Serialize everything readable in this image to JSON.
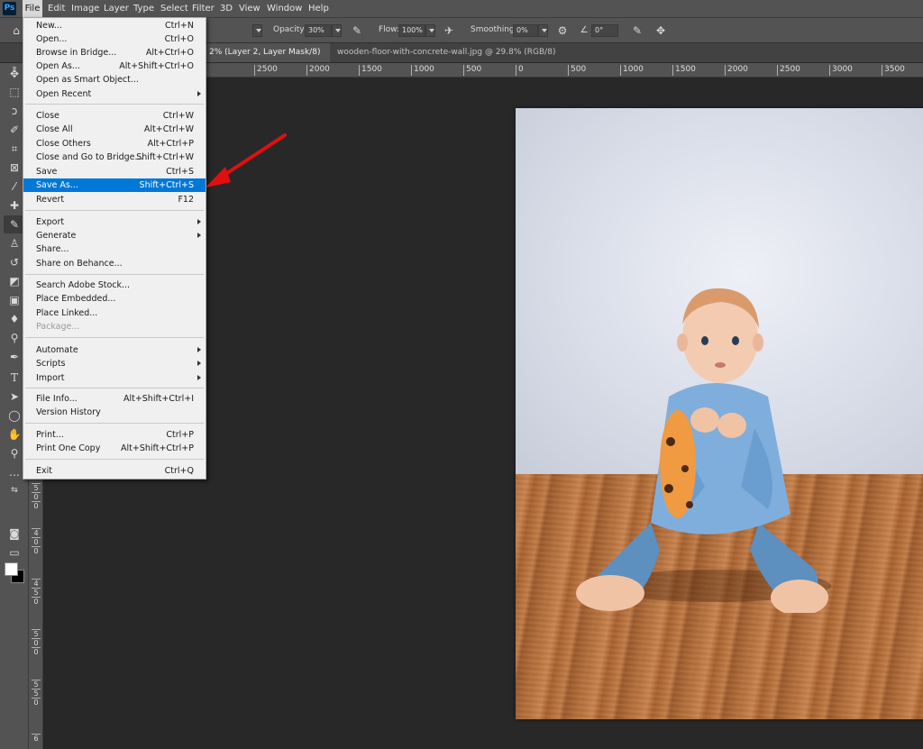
{
  "menubar": {
    "logo": "Ps",
    "items": [
      "File",
      "Edit",
      "Image",
      "Layer",
      "Type",
      "Select",
      "Filter",
      "3D",
      "View",
      "Window",
      "Help"
    ]
  },
  "options": {
    "opacity_label": "Opacity:",
    "opacity_value": "30%",
    "flow_label": "Flow:",
    "flow_value": "100%",
    "smoothing_label": "Smoothing:",
    "smoothing_value": "0%",
    "angle_value": "0°"
  },
  "tabs": [
    {
      "label": "2% (Layer 2, Layer Mask/8) *",
      "close": "×"
    },
    {
      "label": "wooden-floor-with-concrete-wall.jpg @ 29.8% (RGB/8) *",
      "close": "×"
    }
  ],
  "ruler_h": [
    "2500",
    "2000",
    "1500",
    "1000",
    "500",
    "0",
    "500",
    "1000",
    "1500",
    "2000",
    "2500",
    "3000",
    "3500"
  ],
  "ruler_v": [
    "5",
    "0",
    "0",
    "4",
    "0",
    "0",
    "4",
    "5",
    "0",
    "5",
    "0",
    "0",
    "5",
    "5",
    "0",
    "6"
  ],
  "file_menu": {
    "items": [
      {
        "label": "New...",
        "shortcut": "Ctrl+N"
      },
      {
        "label": "Open...",
        "shortcut": "Ctrl+O"
      },
      {
        "label": "Browse in Bridge...",
        "shortcut": "Alt+Ctrl+O"
      },
      {
        "label": "Open As...",
        "shortcut": "Alt+Shift+Ctrl+O"
      },
      {
        "label": "Open as Smart Object...",
        "shortcut": ""
      },
      {
        "label": "Open Recent",
        "shortcut": "",
        "submenu": true
      },
      {
        "label": "Close",
        "shortcut": "Ctrl+W"
      },
      {
        "label": "Close All",
        "shortcut": "Alt+Ctrl+W"
      },
      {
        "label": "Close Others",
        "shortcut": "Alt+Ctrl+P"
      },
      {
        "label": "Close and Go to Bridge...",
        "shortcut": "Shift+Ctrl+W"
      },
      {
        "label": "Save",
        "shortcut": "Ctrl+S"
      },
      {
        "label": "Save As...",
        "shortcut": "Shift+Ctrl+S",
        "highlighted": true
      },
      {
        "label": "Revert",
        "shortcut": "F12"
      },
      {
        "label": "Export",
        "shortcut": "",
        "submenu": true
      },
      {
        "label": "Generate",
        "shortcut": "",
        "submenu": true
      },
      {
        "label": "Share...",
        "shortcut": ""
      },
      {
        "label": "Share on Behance...",
        "shortcut": ""
      },
      {
        "label": "Search Adobe Stock...",
        "shortcut": ""
      },
      {
        "label": "Place Embedded...",
        "shortcut": ""
      },
      {
        "label": "Place Linked...",
        "shortcut": ""
      },
      {
        "label": "Package...",
        "shortcut": "",
        "disabled": true
      },
      {
        "label": "Automate",
        "shortcut": "",
        "submenu": true
      },
      {
        "label": "Scripts",
        "shortcut": "",
        "submenu": true
      },
      {
        "label": "Import",
        "shortcut": "",
        "submenu": true
      },
      {
        "label": "File Info...",
        "shortcut": "Alt+Shift+Ctrl+I"
      },
      {
        "label": "Version History",
        "shortcut": ""
      },
      {
        "label": "Print...",
        "shortcut": "Ctrl+P"
      },
      {
        "label": "Print One Copy",
        "shortcut": "Alt+Shift+Ctrl+P"
      },
      {
        "label": "Exit",
        "shortcut": "Ctrl+Q"
      }
    ]
  },
  "colors": {
    "highlight": "#0078d7",
    "arrow": "#e01010",
    "foreground_swatch": "#ffffff",
    "background_swatch": "#000000"
  }
}
